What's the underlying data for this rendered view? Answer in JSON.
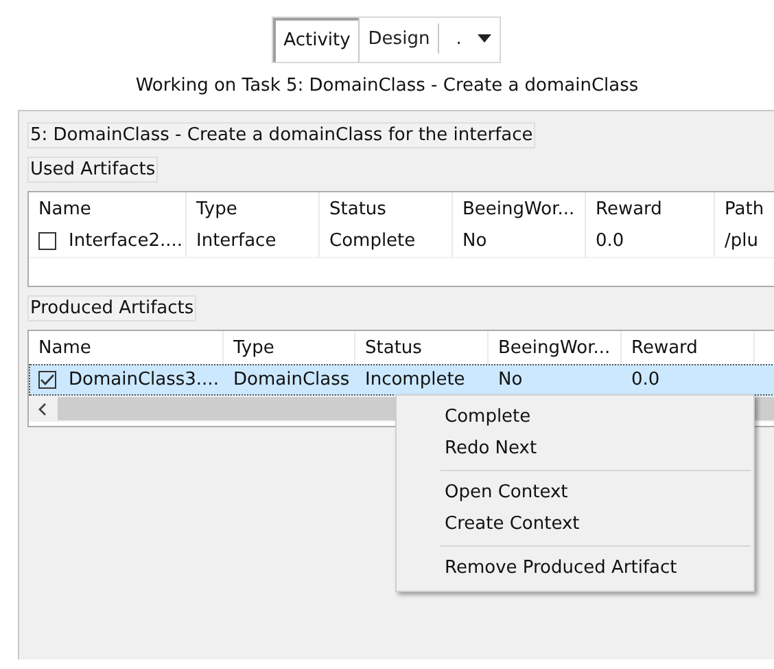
{
  "toolbar": {
    "tabs": [
      {
        "label": "Activity",
        "selected": true
      },
      {
        "label": "Design",
        "selected": false
      }
    ],
    "dropdown": "."
  },
  "subtitle": "Working on Task 5: DomainClass - Create a domainClass",
  "task_title": "5: DomainClass - Create a domainClass for the interface",
  "used_artifacts": {
    "heading": "Used Artifacts",
    "columns": [
      "Name",
      "Type",
      "Status",
      "BeeingWor...",
      "Reward",
      "Path"
    ],
    "rows": [
      {
        "checked": false,
        "selected": false,
        "cells": [
          "Interface2....",
          "Interface",
          "Complete",
          "No",
          "0.0",
          "/plu"
        ]
      }
    ]
  },
  "produced_artifacts": {
    "heading": "Produced Artifacts",
    "columns": [
      "Name",
      "Type",
      "Status",
      "BeeingWor...",
      "Reward"
    ],
    "rows": [
      {
        "checked": true,
        "selected": true,
        "cells": [
          "DomainClass3....",
          "DomainClass",
          "Incomplete",
          "No",
          "0.0"
        ]
      }
    ]
  },
  "context_menu": {
    "groups": [
      [
        "Complete",
        "Redo Next"
      ],
      [
        "Open Context",
        "Create Context"
      ],
      [
        "Remove Produced Artifact"
      ]
    ]
  }
}
